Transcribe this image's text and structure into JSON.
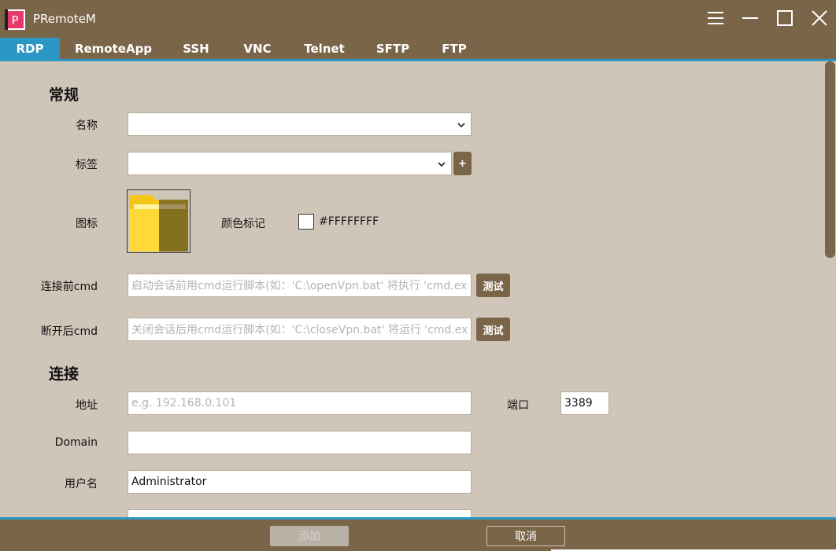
{
  "app": {
    "logo_letter": "P",
    "title": "PRemoteM"
  },
  "tabs": [
    {
      "label": "RDP",
      "active": true
    },
    {
      "label": "RemoteApp"
    },
    {
      "label": "SSH"
    },
    {
      "label": "VNC"
    },
    {
      "label": "Telnet"
    },
    {
      "label": "SFTP"
    },
    {
      "label": "FTP"
    }
  ],
  "general": {
    "heading": "常规",
    "name_label": "名称",
    "name_value": "",
    "tag_label": "标签",
    "tag_value": "",
    "add_tag_button": "+",
    "icon_label": "图标",
    "color_label": "颜色标记",
    "color_value": "#FFFFFFFF",
    "cmd_before_label": "连接前cmd",
    "cmd_before_placeholder": "启动会话前用cmd运行脚本(如：'C:\\openVpn.bat' 将执行 'cmd.exe /c C:\\openVpn.bat')",
    "cmd_after_label": "断开后cmd",
    "cmd_after_placeholder": "关闭会话后用cmd运行脚本(如：'C:\\closeVpn.bat' 将运行 'cmd.exe /c C:\\closeVpn.bat')",
    "test_button": "测试"
  },
  "connection": {
    "heading": "连接",
    "address_label": "地址",
    "address_placeholder": "e.g. 192.168.0.101",
    "port_label": "端口",
    "port_value": "3389",
    "domain_label": "Domain",
    "domain_value": "",
    "username_label": "用户名",
    "username_value": "Administrator"
  },
  "footer": {
    "add_button": "添加",
    "cancel_button": "取消"
  },
  "colors": {
    "title_bar": "#7b6549",
    "content_bg": "#d0c5b9",
    "accent": "#2b97c4",
    "folder_yellow": "#f5c518",
    "folder_olive": "#8a7420"
  }
}
